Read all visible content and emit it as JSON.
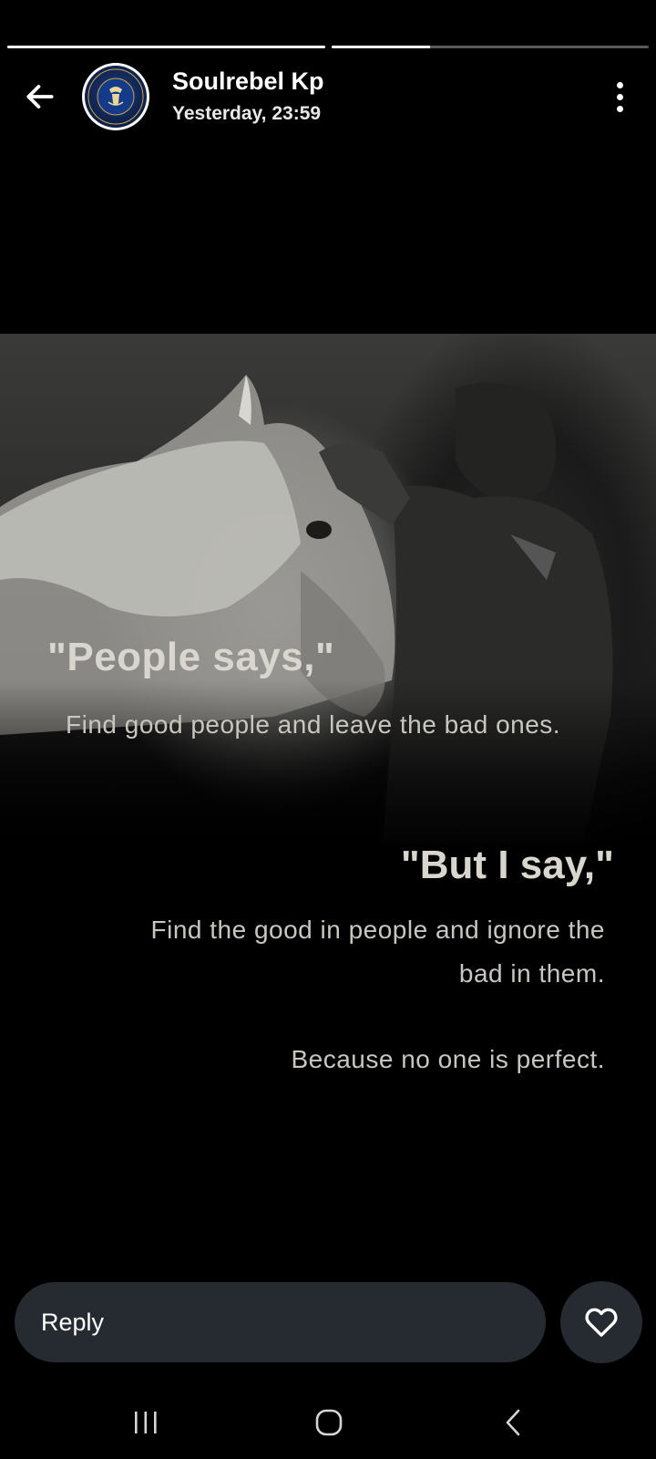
{
  "story": {
    "progress": [
      {
        "segment": 1,
        "fill": 1.0
      },
      {
        "segment": 2,
        "fill": 0.31
      }
    ]
  },
  "header": {
    "user_name": "Soulrebel Kp",
    "timestamp": "Yesterday, 23:59",
    "avatar_text_top": "BLUEBLOOD",
    "avatar_text_bottom": "FOR LIFE"
  },
  "content": {
    "quote_title_1": "\"People says,\"",
    "quote_body_1": "Find good people and leave the bad ones.",
    "quote_title_2": "\"But I say,\"",
    "quote_body_2": "Find the good in people and ignore the bad in them.",
    "quote_body_3": "Because no one is perfect."
  },
  "reply": {
    "placeholder": "Reply"
  },
  "colors": {
    "background": "#000000",
    "input_bg": "#262a31",
    "text": "#ffffff"
  },
  "icons": {
    "back": "arrow-left-icon",
    "more": "more-vertical-icon",
    "like": "heart-icon",
    "nav_recent": "recent-apps-icon",
    "nav_home": "home-icon",
    "nav_back": "chevron-left-icon"
  }
}
